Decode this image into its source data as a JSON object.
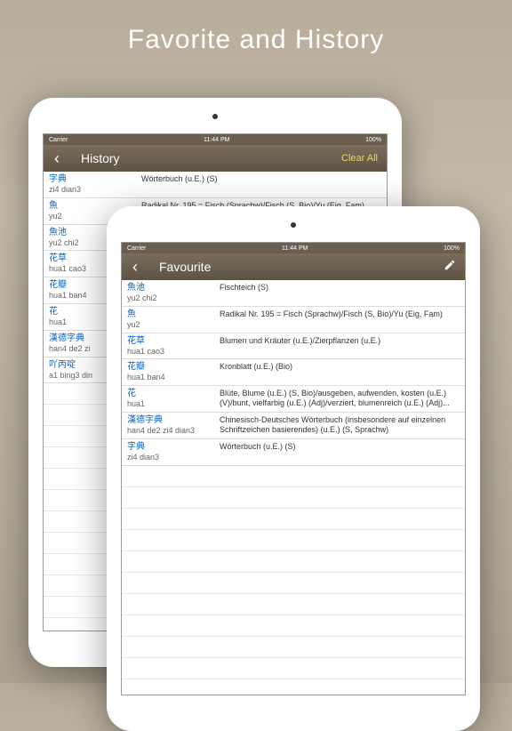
{
  "promo": {
    "title": "Favorite and History"
  },
  "status": {
    "carrier": "Carrier",
    "time": "11:44 PM",
    "battery": "100%"
  },
  "history": {
    "title": "History",
    "clear": "Clear All",
    "rows": [
      {
        "term": "字典",
        "pinyin": "zi4 dian3",
        "def": "Wörterbuch (u.E.) (S)"
      },
      {
        "term": "魚",
        "pinyin": "yu2",
        "def": "Radikal Nr. 195 = Fisch (Sprachw)/Fisch (S, Bio)/Yu (Eig, Fam)"
      },
      {
        "term": "魚池",
        "pinyin": "yu2 chi2",
        "def": ""
      },
      {
        "term": "花草",
        "pinyin": "hua1 cao3",
        "def": ""
      },
      {
        "term": "花瓣",
        "pinyin": "hua1 ban4",
        "def": ""
      },
      {
        "term": "花",
        "pinyin": "hua1",
        "def": ""
      },
      {
        "term": "漢德字典",
        "pinyin": "han4 de2 zi",
        "def": ""
      },
      {
        "term": "吖丙啶",
        "pinyin": "a1 bing3 din",
        "def": ""
      }
    ]
  },
  "favourite": {
    "title": "Favourite",
    "rows": [
      {
        "term": "魚池",
        "pinyin": "yu2 chi2",
        "def": "Fischteich (S)"
      },
      {
        "term": "魚",
        "pinyin": "yu2",
        "def": "Radikal Nr. 195 = Fisch (Sprachw)/Fisch (S, Bio)/Yu (Eig, Fam)"
      },
      {
        "term": "花草",
        "pinyin": "hua1 cao3",
        "def": "Blumen und Kräuter (u.E.)/Zierpflanzen (u.E.)"
      },
      {
        "term": "花瓣",
        "pinyin": "hua1 ban4",
        "def": "Kronblatt (u.E.) (Bio)"
      },
      {
        "term": "花",
        "pinyin": "hua1",
        "def": "Blüte, Blume (u.E.) (S, Bio)/ausgeben, aufwenden, kosten (u.E.) (V)/bunt, vielfarbig (u.E.) (Adj)/verziert, blumenreich (u.E.) (Adj)..."
      },
      {
        "term": "漢德字典",
        "pinyin": "han4 de2 zi4 dian3",
        "def": "Chinesisch-Deutsches Wörterbuch (insbesondere auf einzelnen Schriftzeichen basierendes) (u.E.) (S, Sprachw)"
      },
      {
        "term": "字典",
        "pinyin": "zi4 dian3",
        "def": "Wörterbuch (u.E.) (S)"
      }
    ]
  }
}
